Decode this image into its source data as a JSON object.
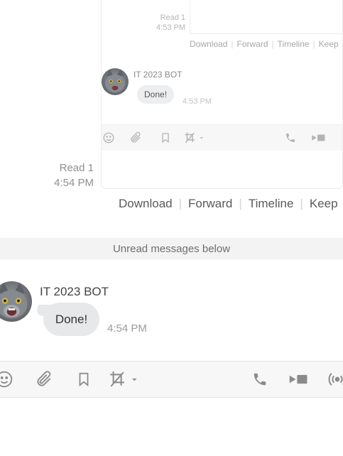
{
  "nested": {
    "read_count": "Read 1",
    "read_time": "4:53 PM",
    "actions": [
      "Download",
      "Forward",
      "Timeline",
      "Keep"
    ],
    "bot_name": "IT 2023 BOT",
    "message_text": "Done!",
    "message_time": "4:53 PM"
  },
  "main": {
    "read_count": "Read 1",
    "read_time": "4:54 PM",
    "actions": [
      "Download",
      "Forward",
      "Timeline",
      "Keep"
    ],
    "unread_divider": "Unread messages below",
    "bot_name": "IT 2023 BOT",
    "message_text": "Done!",
    "message_time": "4:54 PM"
  },
  "toolbar_icons": [
    "emoji-icon",
    "attachment-icon",
    "bookmark-icon",
    "crop-icon",
    "call-icon",
    "video-icon",
    "broadcast-icon"
  ],
  "colors": {
    "bubble": "#e6e8ea",
    "toolbar_bg": "#f7f7f7",
    "icon": "#8a8a8a"
  }
}
